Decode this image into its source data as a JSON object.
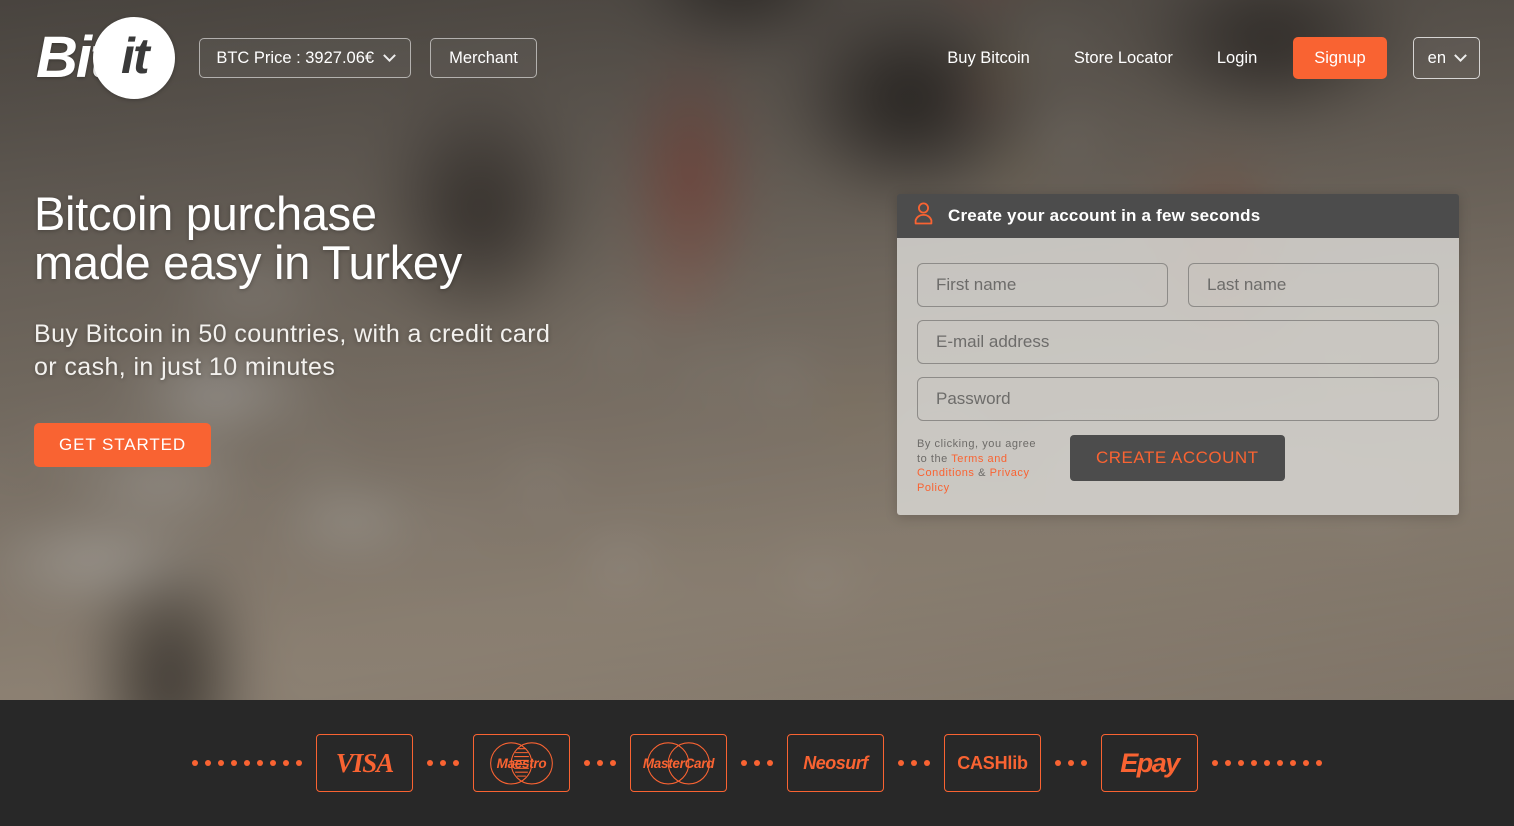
{
  "brand": {
    "logo_primary": "Bit",
    "logo_circle": "it",
    "accent_color": "#f96332",
    "dark_color": "#4c4c4c",
    "footer_color": "#282828"
  },
  "nav": {
    "btc_price_label": "BTC Price : 3927.06€",
    "btc_chevron_icon": "chevron-down-icon",
    "merchant_label": "Merchant",
    "links": [
      {
        "label": "Buy Bitcoin",
        "name": "buy-bitcoin"
      },
      {
        "label": "Store Locator",
        "name": "store-locator"
      },
      {
        "label": "Login",
        "name": "login"
      }
    ],
    "signup_label": "Signup",
    "language_label": "en",
    "language_chevron_icon": "chevron-down-icon"
  },
  "hero": {
    "headline_line1": "Bitcoin purchase",
    "headline_line2": "made easy in Turkey",
    "subline_line1": "Buy Bitcoin in 50 countries, with a credit card",
    "subline_line2": "or cash, in just 10 minutes",
    "cta_label": "GET STARTED"
  },
  "signup_form": {
    "panel_icon": "user-icon",
    "panel_title": "Create your account in a few seconds",
    "first_name_placeholder": "First name",
    "first_name_value": "",
    "last_name_placeholder": "Last name",
    "last_name_value": "",
    "email_placeholder": "E-mail address",
    "email_value": "",
    "password_placeholder": "Password",
    "password_value": "",
    "agree_prefix": "By clicking, you agree to the ",
    "terms_link": "Terms and Conditions",
    "agree_amp": " & ",
    "privacy_link": "Privacy Policy",
    "submit_label": "CREATE ACCOUNT"
  },
  "footer": {
    "payment_methods": [
      {
        "name": "visa",
        "label": "VISA"
      },
      {
        "name": "maestro",
        "label": "Maestro"
      },
      {
        "name": "mastercard",
        "label": "MasterCard"
      },
      {
        "name": "neosurf",
        "label": "Neosurf"
      },
      {
        "name": "cashlib",
        "label": "CASHlib"
      },
      {
        "name": "epay",
        "label": "Epay"
      }
    ]
  }
}
